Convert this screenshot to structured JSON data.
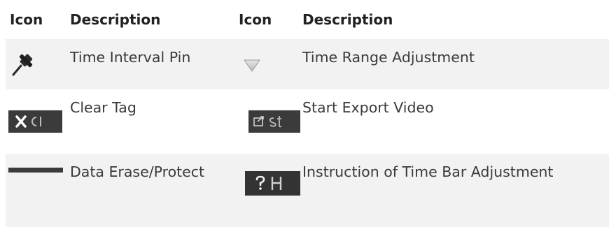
{
  "header": {
    "col1": "Icon",
    "col2": "Description",
    "col3": "Icon",
    "col4": "Description"
  },
  "rows": [
    {
      "left_icon": "pin-icon",
      "left_description": "Time Interval Pin",
      "right_icon": "triangle-down-icon",
      "right_description": "Time Range Adjustment"
    },
    {
      "left_icon": "clear-tag-button-icon",
      "left_description": "Clear Tag",
      "right_icon": "start-export-button-icon",
      "right_description": "Start Export Video"
    },
    {
      "left_icon": "data-erase-protect-button-icon",
      "left_description": "Data Erase/Protect",
      "right_icon": "help-button-icon",
      "right_description": "Instruction of Time Bar Adjustment"
    }
  ],
  "colors": {
    "shaded_row": "#f2f2f2",
    "button_bg": "#3b3b3b"
  }
}
